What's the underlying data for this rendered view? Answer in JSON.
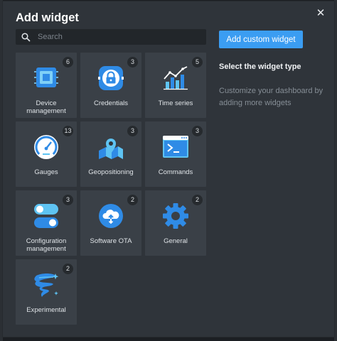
{
  "dialog": {
    "title": "Add widget",
    "close_glyph": "✕"
  },
  "search": {
    "placeholder": "Search",
    "value": ""
  },
  "custom_button": {
    "label": "Add custom widget"
  },
  "side": {
    "heading": "Select the widget type",
    "description": "Customize your dashboard by adding more widgets"
  },
  "tiles": [
    {
      "label": "Device management",
      "count": "6",
      "icon": "device-chip-icon"
    },
    {
      "label": "Credentials",
      "count": "3",
      "icon": "lock-icon"
    },
    {
      "label": "Time series",
      "count": "5",
      "icon": "bar-chart-trend-icon"
    },
    {
      "label": "Gauges",
      "count": "13",
      "icon": "gauge-icon"
    },
    {
      "label": "Geopositioning",
      "count": "3",
      "icon": "map-pin-icon"
    },
    {
      "label": "Commands",
      "count": "3",
      "icon": "terminal-icon"
    },
    {
      "label": "Configuration management",
      "count": "3",
      "icon": "toggles-icon"
    },
    {
      "label": "Software OTA",
      "count": "2",
      "icon": "cloud-upload-icon"
    },
    {
      "label": "General",
      "count": "2",
      "icon": "gear-icon"
    },
    {
      "label": "Experimental",
      "count": "2",
      "icon": "tornado-sparkle-icon"
    }
  ],
  "colors": {
    "accent": "#3b9df2",
    "icon_blue": "#2f8be6",
    "icon_light": "#5ec3f2",
    "dialog_bg": "#2f343a",
    "tile_bg": "#3a4047"
  }
}
